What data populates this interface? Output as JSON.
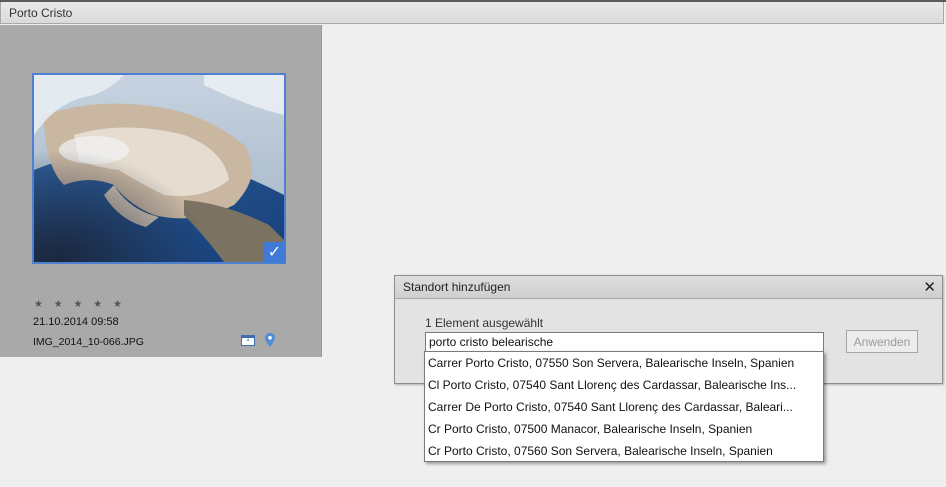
{
  "header": {
    "title": "Porto Cristo"
  },
  "photo": {
    "rating_stars": "★ ★ ★ ★ ★",
    "date": "21.10.2014 09:58",
    "filename": "IMG_2014_10-066.JPG",
    "calendar_badge": "1",
    "selected": true
  },
  "dialog": {
    "title": "Standort hinzufügen",
    "close_label": "✕",
    "selected_count": "1 Element ausgewählt",
    "search_value": "porto cristo belearische",
    "apply_label": "Anwenden",
    "suggestions": [
      "Carrer Porto Cristo, 07550 Son Servera, Balearische Inseln, Spanien",
      "Cl Porto Cristo, 07540 Sant Llorenç des Cardassar, Balearische Ins...",
      "Carrer De Porto Cristo, 07540 Sant Llorenç des Cardassar, Baleari...",
      "Cr Porto Cristo, 07500 Manacor, Balearische Inseln, Spanien",
      "Cr Porto Cristo, 07560 Son Servera, Balearische Inseln, Spanien"
    ]
  },
  "colors": {
    "accent": "#3f7ad6",
    "panel": "#a9a9a9",
    "background": "#efefef"
  }
}
